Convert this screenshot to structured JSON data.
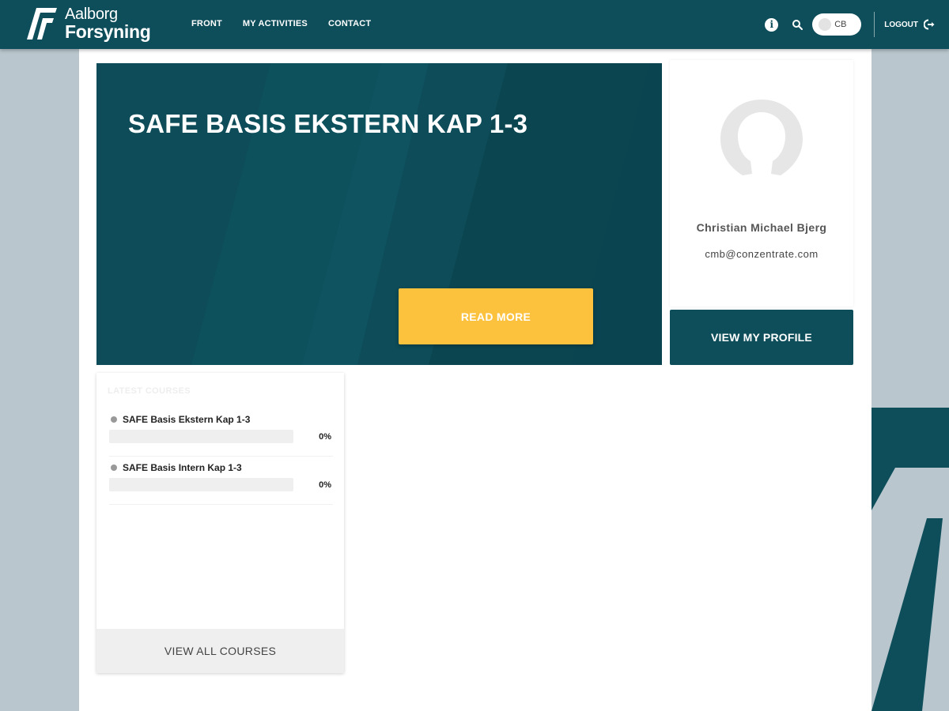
{
  "brand": {
    "line1": "Aalborg",
    "line2": "Forsyning",
    "colors": {
      "primary": "#0e4e5b",
      "accent": "#fcc23e",
      "page_bg": "#b9c6cd"
    }
  },
  "nav": {
    "items": [
      {
        "label": "FRONT"
      },
      {
        "label": "MY ACTIVITIES"
      },
      {
        "label": "CONTACT"
      }
    ]
  },
  "header": {
    "info_icon": "info-icon",
    "search_icon": "search-icon",
    "user_initials": "CB",
    "logout_label": "LOGOUT"
  },
  "hero": {
    "title": "SAFE BASIS EKSTERN KAP 1-3",
    "button_label": "READ MORE"
  },
  "profile": {
    "name": "Christian Michael Bjerg",
    "email": "cmb@conzentrate.com",
    "button_label": "VIEW MY PROFILE"
  },
  "courses": {
    "heading": "LATEST COURSES",
    "items": [
      {
        "name": "SAFE Basis Ekstern Kap 1-3",
        "progress": 0,
        "progress_label": "0%"
      },
      {
        "name": "SAFE Basis Intern Kap 1-3",
        "progress": 0,
        "progress_label": "0%"
      }
    ],
    "view_all_label": "VIEW ALL COURSES"
  }
}
